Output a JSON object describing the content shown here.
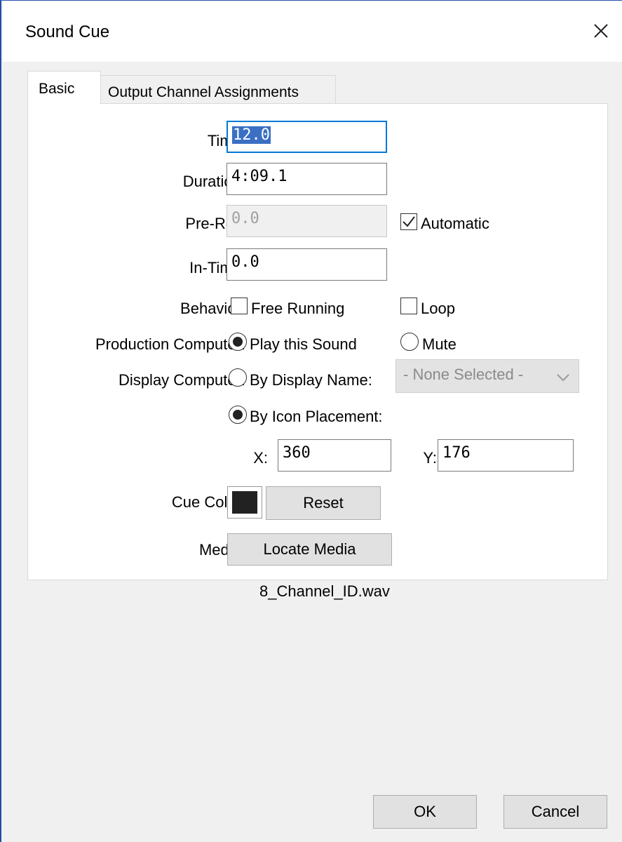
{
  "window": {
    "title": "Sound Cue"
  },
  "tabs": [
    {
      "label": "Basic",
      "active": true
    },
    {
      "label": "Output Channel Assignments",
      "active": false
    }
  ],
  "form": {
    "time": {
      "label": "Time:",
      "value": "12.0"
    },
    "duration": {
      "label": "Duration:",
      "value": "4:09.1"
    },
    "preroll": {
      "label": "Pre-Roll:",
      "value": "0.0",
      "disabled": true
    },
    "automatic": {
      "label": "Automatic",
      "checked": true
    },
    "intime": {
      "label": "In-Time:",
      "value": "0.0"
    },
    "behavior": {
      "label": "Behavior:",
      "free_running": {
        "label": "Free Running",
        "checked": false
      },
      "loop": {
        "label": "Loop",
        "checked": false
      }
    },
    "production": {
      "label": "Production Computer:",
      "play": {
        "label": "Play this Sound",
        "selected": true
      },
      "mute": {
        "label": "Mute",
        "selected": false
      }
    },
    "display": {
      "label": "Display Computer:",
      "by_name": {
        "label": "By Display Name:",
        "selected": false
      },
      "name_select": {
        "value": "- None Selected -"
      },
      "by_icon": {
        "label": "By Icon Placement:",
        "selected": true
      },
      "x": {
        "label": "X:",
        "value": "360"
      },
      "y": {
        "label": "Y:",
        "value": "176"
      }
    },
    "cue_color": {
      "label": "Cue Color:",
      "color": "#222222",
      "reset_label": "Reset"
    },
    "media": {
      "label": "Media:",
      "locate_label": "Locate Media",
      "filename": "8_Channel_ID.wav"
    }
  },
  "footer": {
    "ok_label": "OK",
    "cancel_label": "Cancel"
  },
  "icons": {
    "close": "close-icon",
    "dropdown": "chevron-down-icon",
    "check": "checkmark-icon"
  },
  "colors": {
    "accent": "#0078d7",
    "selection": "#3a6fc4",
    "window_border": "#1f4fa8"
  }
}
